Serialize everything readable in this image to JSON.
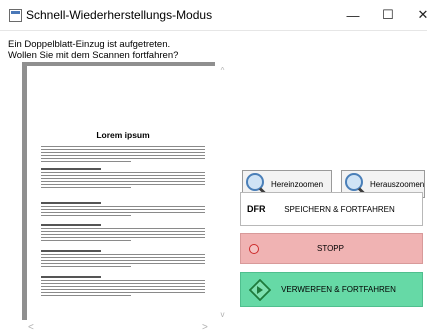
{
  "window": {
    "title": "Schnell-Wiederherstellungs-Modus",
    "minimize_glyph": "—",
    "maximize_glyph": "☐",
    "close_glyph": "✕"
  },
  "message": {
    "line1": "Ein Doppelblatt-Einzug ist aufgetreten.",
    "line2": "Wollen Sie mit dem Scannen fortfahren?"
  },
  "preview": {
    "document_title": "Lorem ipsum"
  },
  "scrollbars": {
    "up_arrow": "^",
    "down_arrow": "v",
    "left_arrow": "<",
    "right_arrow": ">"
  },
  "buttons": {
    "zoom_in": {
      "label": "Hereinzoomen",
      "icon": "magnifier-plus-icon"
    },
    "zoom_out": {
      "label": "Herauszoomen",
      "icon": "magnifier-minus-icon"
    },
    "save_continue": {
      "badge": "DFR",
      "label": "SPEICHERN & FORTFAHREN"
    },
    "stop": {
      "label": "STOPP",
      "icon": "stop-circle-icon",
      "color": "#f0b3b3"
    },
    "discard_continue": {
      "label": "VERWERFEN & FORTFAHREN",
      "icon": "diamond-arrow-icon",
      "color": "#66d9a6"
    }
  }
}
